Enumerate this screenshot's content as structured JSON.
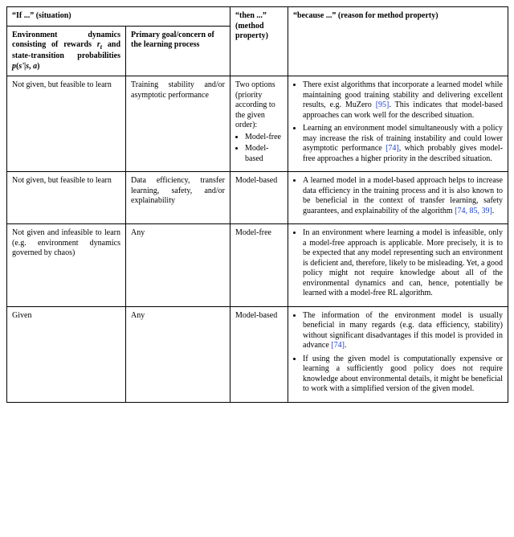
{
  "headers": {
    "if_label": "“If ...” (situation)",
    "sub_env": "Environment dynamics consisting of rewards r_t and state-transition probabilities p(s'|s, a)",
    "sub_goal": "Primary goal/concern of the learning process",
    "then_label": "“then ...” (method property)",
    "because_label": "“because ...” (reason for method property)"
  },
  "rows": [
    {
      "env": "Not given, but feasible to learn",
      "goal": "Training stability and/or asymptotic performance",
      "then_intro": "Two options (priority according to the given order):",
      "then_items": [
        "Model-free",
        "Model-based"
      ],
      "reasons": [
        {
          "pre": "There exist algorithms that incorporate a learned model while maintaining good training stability and delivering excellent results, e.g. MuZero ",
          "ref": "[95]",
          "post": ". This indicates that model-based approaches can work well for the described situation."
        },
        {
          "pre": "Learning an environment model simultaneously with a policy may increase the risk of training instability and could lower asymptotic performance ",
          "ref": "[74]",
          "post": ", which probably gives model-free approaches a higher priority in the described situation."
        }
      ]
    },
    {
      "env": "Not given, but feasible to learn",
      "goal": "Data efficiency, transfer learning, safety, and/or explainability",
      "then_simple": "Model-based",
      "reasons": [
        {
          "pre": "A learned model in a model-based approach helps to increase data efficiency in the training process and it is also known to be beneficial in the context of transfer learning, safety guarantees, and explainability of the algorithm ",
          "ref": "[74, 85, 39]",
          "post": "."
        }
      ]
    },
    {
      "env": "Not given and infeasible to learn (e.g. environment dynamics governed by chaos)",
      "goal": "Any",
      "then_simple": "Model-free",
      "reasons": [
        {
          "pre": "In an environment where learning a model is infeasible, only a model-free approach is applicable. More precisely, it is to be expected that any model representing such an environment is deficient and, therefore, likely to be misleading. Yet, a good policy might not require knowledge about all of the environmental dynamics and can, hence, potentially be learned with a model-free RL algorithm.",
          "ref": "",
          "post": ""
        }
      ]
    },
    {
      "env": "Given",
      "goal": "Any",
      "then_simple": "Model-based",
      "reasons": [
        {
          "pre": "The information of the environment model is usually beneficial in many regards (e.g. data efficiency, stability) without significant disadvantages if this model is provided in advance ",
          "ref": "[74]",
          "post": "."
        },
        {
          "pre": "If using the given model is computationally expensive or learning a sufficiently good policy does not require knowledge about environmental details, it might be beneficial to work with a simplified version of the given model.",
          "ref": "",
          "post": ""
        }
      ]
    }
  ]
}
